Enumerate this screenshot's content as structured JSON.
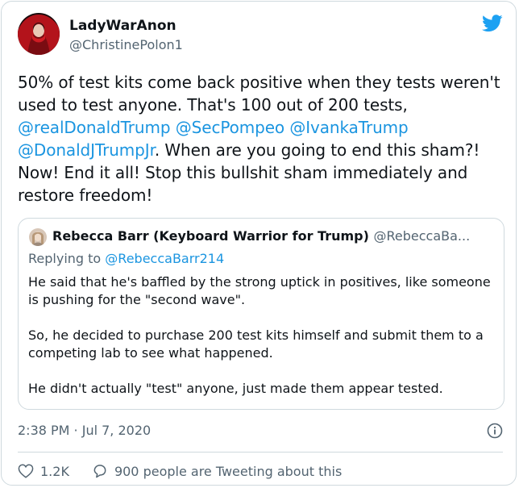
{
  "tweet": {
    "author": {
      "display_name": "LadyWarAnon",
      "handle": "@ChristinePolon1",
      "avatar": "avatar-red-scarf"
    },
    "segments": [
      {
        "text": "50% of test kits come back positive when they tests weren't used to test anyone. That's 100 out of 200 tests, ",
        "mention": false
      },
      {
        "text": "@realDonaldTrump",
        "mention": true
      },
      {
        "text": " ",
        "mention": false
      },
      {
        "text": "@SecPompeo",
        "mention": true
      },
      {
        "text": " ",
        "mention": false
      },
      {
        "text": "@IvankaTrump",
        "mention": true
      },
      {
        "text": " ",
        "mention": false
      },
      {
        "text": "@DonaldJTrumpJr",
        "mention": true
      },
      {
        "text": ". When are you going to end this sham?! Now! End it all! Stop this bullshit sham immediately and restore freedom!",
        "mention": false
      }
    ],
    "timestamp": "2:38 PM · Jul 7, 2020",
    "likes": "1.2K",
    "people_tweeting": "900 people are Tweeting about this",
    "icons": [
      "twitter-bird-icon",
      "info-icon",
      "heart-icon",
      "comment-icon"
    ],
    "colors": {
      "mention": "#1b95e0",
      "bird": "#1da1f2",
      "secondary_text": "#536471"
    }
  },
  "quote": {
    "display_name": "Rebecca Barr (Keyboard Warrior for Trump)",
    "handle": "@RebeccaBa...",
    "replying_prefix": "Replying to ",
    "replying_to": "@RebeccaBarr214",
    "paragraphs": [
      "He said that he's baffled by the strong uptick in positives, like someone is pushing for the \"second wave\".",
      "So, he decided to purchase 200 test kits himself and submit them to a competing lab to see what happened.",
      "He didn't actually \"test\" anyone, just made them appear tested."
    ]
  }
}
